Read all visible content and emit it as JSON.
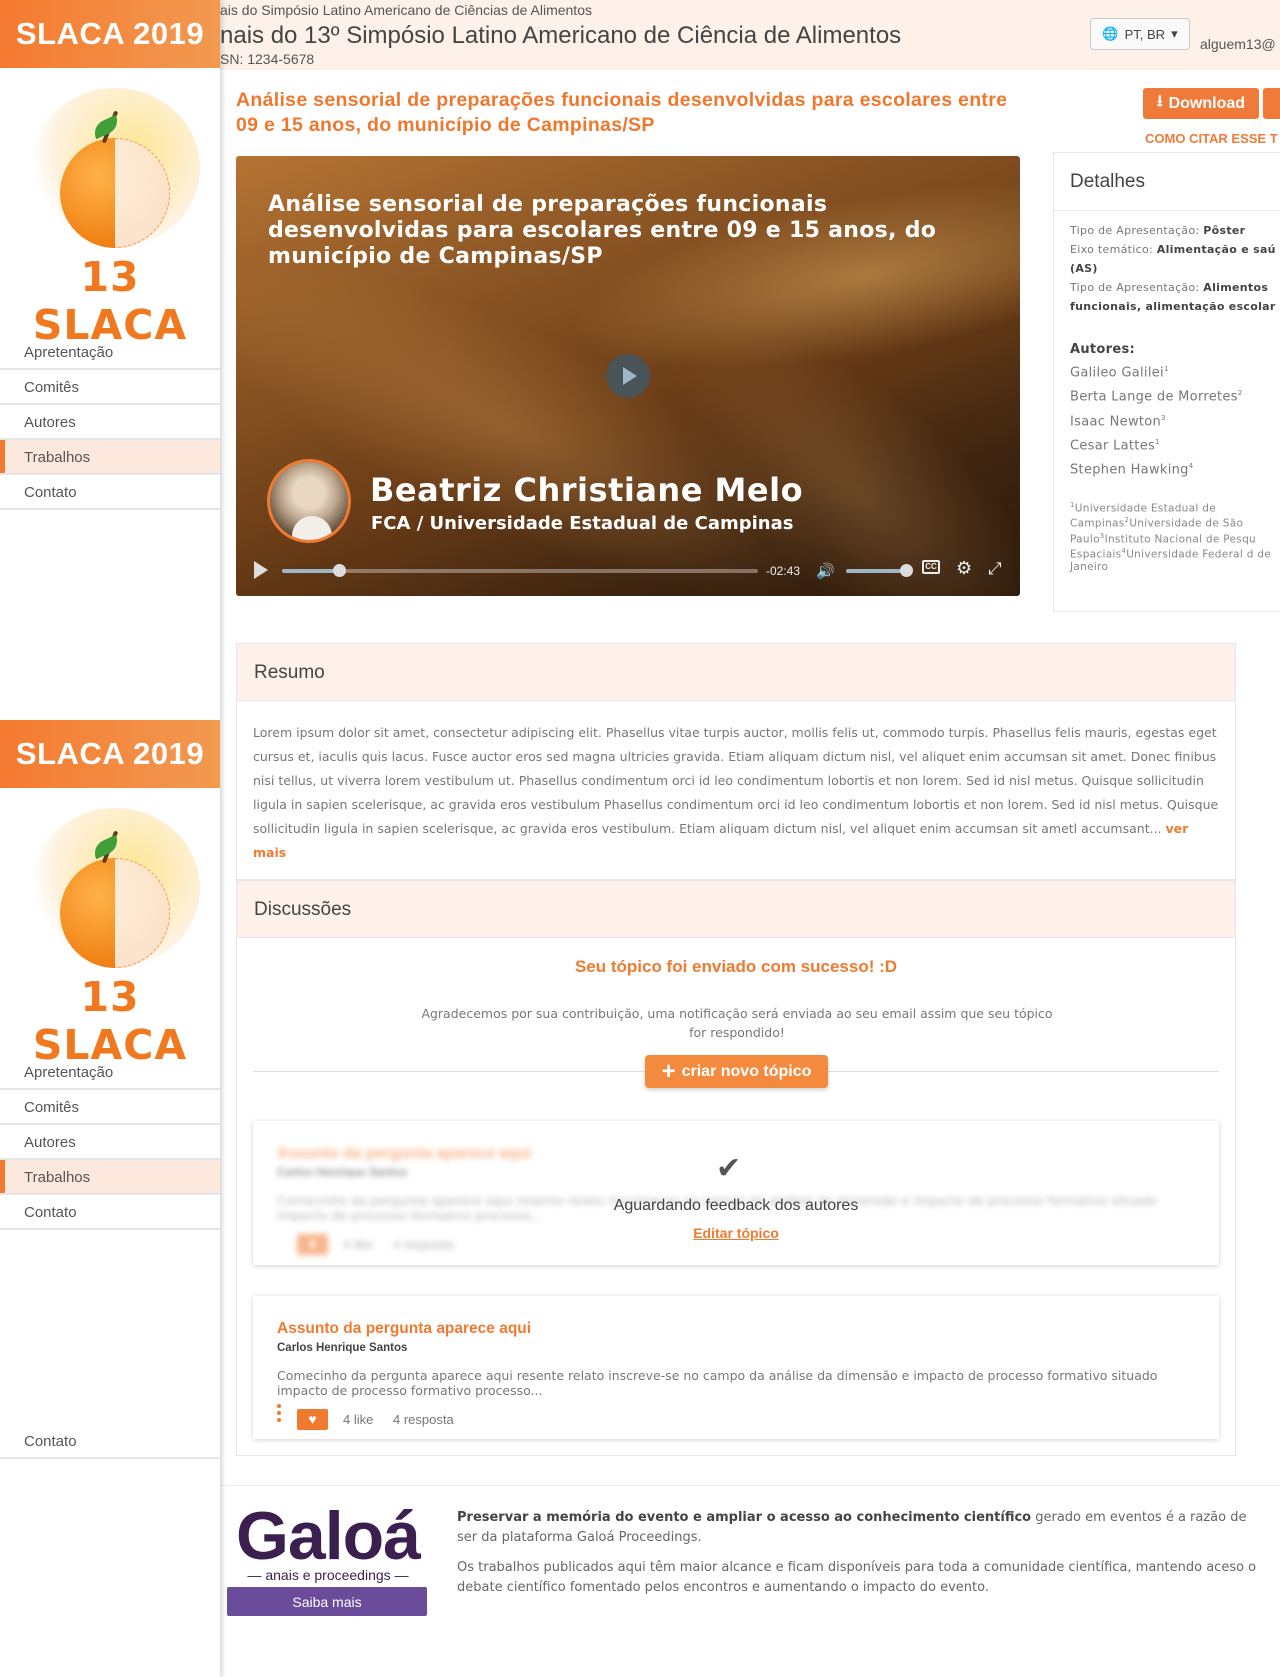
{
  "sidebar": {
    "brand": "SLACA 2019",
    "logo_text": "13 SLACA",
    "nav": [
      "Apretentação",
      "Comitês",
      "Autores",
      "Trabalhos",
      "Contato"
    ],
    "active_index": 3,
    "stray_item": "Contato"
  },
  "header": {
    "proceedings_small": "ais do Simpósio Latino Americano de Ciências de Alimentos",
    "event_title": "nais do 13º Simpósio Latino Americano de Ciência de Alimentos",
    "issn": "SN: 1234-5678",
    "language": "PT, BR",
    "user_email": "alguem13@"
  },
  "work": {
    "title": "Análise sensorial de preparações funcionais desenvolvidas para escolares entre 09 e 15 anos, do município de Campinas/SP",
    "download_label": "Download",
    "cite_label": "COMO CITAR ESSE T"
  },
  "video": {
    "title": "Análise sensorial de preparações funcionais desenvolvidas para escolares entre 09 e 15 anos, do município de Campinas/SP",
    "speaker": "Beatriz Christiane Melo",
    "institution": "FCA / Universidade Estadual de Campinas",
    "time_remaining": "-02:43",
    "progress": 0.12,
    "volume": 0.9,
    "cc_label": "CC"
  },
  "details": {
    "heading": "Detalhes",
    "rows": [
      {
        "label": "Tipo de Apresentação:",
        "value": "Pôster"
      },
      {
        "label": "Eixo temático:",
        "value": "Alimentação e saú (AS)"
      },
      {
        "label": "Tipo de Apresentação:",
        "value": "Alimentos funcionais, alimentação escolar"
      }
    ],
    "authors_heading": "Autores:",
    "authors": [
      {
        "name": "Galileo Galilei",
        "sup": "1"
      },
      {
        "name": "Berta Lange de Morretes",
        "sup": "2"
      },
      {
        "name": "Isaac Newton",
        "sup": "3"
      },
      {
        "name": "Cesar Lattes",
        "sup": "1"
      },
      {
        "name": "Stephen Hawking",
        "sup": "4"
      }
    ],
    "affiliations": [
      {
        "sup": "1",
        "name": "Universidade Estadual de Campinas"
      },
      {
        "sup": "2",
        "name": "Universidade de São Paulo"
      },
      {
        "sup": "3",
        "name": "Instituto Nacional de Pesqu Espaciais"
      },
      {
        "sup": "4",
        "name": "Universidade Federal d de Janeiro"
      }
    ]
  },
  "resumo": {
    "heading": "Resumo",
    "text": "Lorem ipsum dolor sit amet, consectetur adipiscing elit. Phasellus vitae turpis auctor, mollis felis ut, commodo turpis. Phasellus felis mauris, egestas eget cursus et, iaculis quis lacus. Fusce auctor eros sed magna ultricies gravida. Etiam aliquam dictum nisl, vel aliquet enim accumsan sit amet. Donec finibus nisi tellus, ut viverra lorem vestibulum ut. Phasellus condimentum orci id leo condimentum lobortis et non lorem. Sed id nisl metus. Quisque sollicitudin ligula in sapien scelerisque, ac gravida eros vestibulum Phasellus condimentum orci id leo condimentum lobortis et non lorem. Sed id nisl metus. Quisque sollicitudin ligula in sapien scelerisque, ac gravida eros vestibulum. Etiam aliquam dictum nisl, vel aliquet enim accumsan sit ametl accumsant...",
    "more": "ver mais"
  },
  "discussions": {
    "heading": "Discussões",
    "success": "Seu tópico foi enviado com sucesso! :D",
    "note": "Agradecemos por sua contribuição, uma notificação será enviada ao seu email assim que seu tópico for respondido!",
    "new_topic": "criar novo tópico",
    "pending": {
      "status": "Aguardando feedback dos autores",
      "edit": "Editar tópico"
    },
    "question": {
      "title": "Assunto da pergunta aparece aqui",
      "author": "Carlos Henrique Santos",
      "text": "Comecinho da pergunta aparece aqui resente relato inscreve-se no campo da análise da dimensão e impacto de processo formativo situado impacto de processo formativo processo...",
      "likes": "4 like",
      "replies": "4 resposta"
    }
  },
  "footer": {
    "logo": "Galoá",
    "logo_sub": "anais e proceedings",
    "cta": "Saiba mais",
    "p1_bold": "Preservar a memória do evento e ampliar o acesso ao conhecimento científico",
    "p1_rest": " gerado em eventos é a razão de ser da plataforma Galoá Proceedings.",
    "p2": "Os trabalhos publicados aqui têm maior alcance e ficam disponíveis para toda a comunidade científica, mantendo aceso o debate científico fomentado pelos encontros e aumentando o impacto do evento."
  },
  "colors": {
    "accent": "#f07a30",
    "header_bg": "#fdf1ea",
    "galoa_purple": "#6b4c9a"
  }
}
